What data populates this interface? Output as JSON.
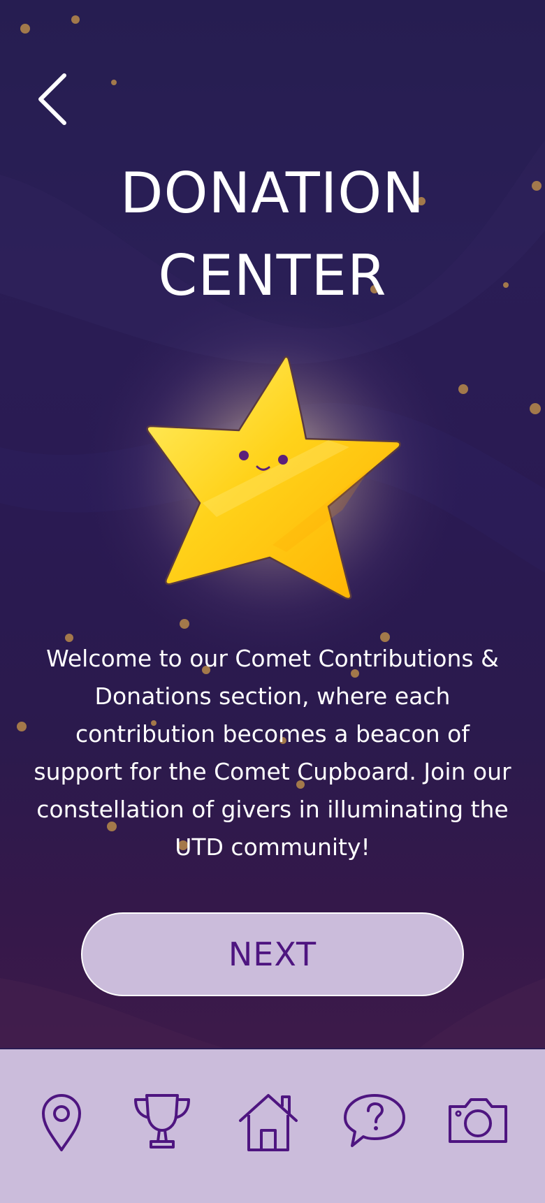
{
  "header": {
    "back_icon": "chevron-left-icon",
    "title_line1": "DONATION",
    "title_line2": "CENTER"
  },
  "hero": {
    "illustration": "smiling-star"
  },
  "description": "Welcome to our Comet Contributions & Donations section, where each contribution becomes a beacon of support for the Comet Cupboard. Join our constellation of givers in illuminating the UTD community!",
  "next_button": {
    "label": "NEXT"
  },
  "bottom_nav": {
    "items": [
      {
        "icon": "location-pin-icon"
      },
      {
        "icon": "trophy-icon"
      },
      {
        "icon": "home-icon"
      },
      {
        "icon": "help-chat-icon"
      },
      {
        "icon": "camera-icon"
      }
    ]
  },
  "colors": {
    "background_top": "#231a4a",
    "background_bottom": "#3d1a4a",
    "star_yellow": "#ffd21a",
    "button_fill": "#cbbcdb",
    "button_text": "#4e1580",
    "nav_icon": "#4e1580",
    "nav_bg": "#cbbcdb"
  }
}
